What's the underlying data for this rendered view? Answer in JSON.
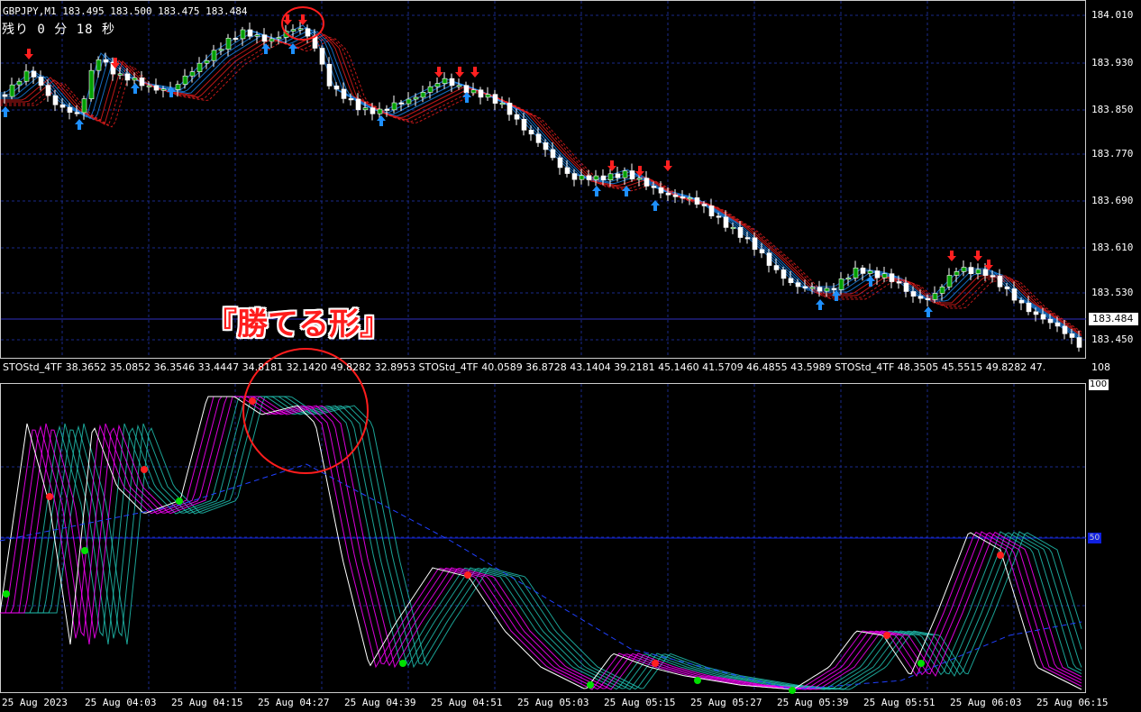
{
  "window": {
    "symbol_line": "GBPJPY,M1  183.495 183.500 183.475 183.484",
    "timer": "残り 0 分 18 秒"
  },
  "price_axis": {
    "ticks": [
      "184.010",
      "183.930",
      "183.850",
      "183.770",
      "183.690",
      "183.610",
      "183.530",
      "183.450"
    ],
    "current_price": "183.484"
  },
  "indicator": {
    "label": "STOStd_4TF 38.3652 35.0852 36.3546 33.4447 34.8181 32.1420 49.8282 32.8953  STOStd_4TF 40.0589 36.8728 43.1404 39.2181 45.1460 41.5709 46.4855 43.5989  STOStd_4TF 48.3505 45.5515 49.8282 47.",
    "axis_top": "108",
    "axis_max": "100",
    "level_badge": "50"
  },
  "time_axis": {
    "ticks": [
      "25 Aug 2023",
      "25 Aug 04:03",
      "25 Aug 04:15",
      "25 Aug 04:27",
      "25 Aug 04:39",
      "25 Aug 04:51",
      "25 Aug 05:03",
      "25 Aug 05:15",
      "25 Aug 05:27",
      "25 Aug 05:39",
      "25 Aug 05:51",
      "25 Aug 06:03",
      "25 Aug 06:15"
    ]
  },
  "annotation": {
    "text": "『勝てる形』",
    "color": "#ff1d1d"
  },
  "colors": {
    "background": "#000000",
    "grid": "#1a2a8a",
    "bull_candle": "#00a000",
    "bear_candle": "#ffffff",
    "up_arrow": "#1e90ff",
    "down_arrow": "#ff2020",
    "ma_bull": "#1e90ff",
    "ma_bear": "#ff2020",
    "stoch_fast": "#ff00ff",
    "stoch_slow": "#20c0b0",
    "level_line": "#1020e0"
  }
}
